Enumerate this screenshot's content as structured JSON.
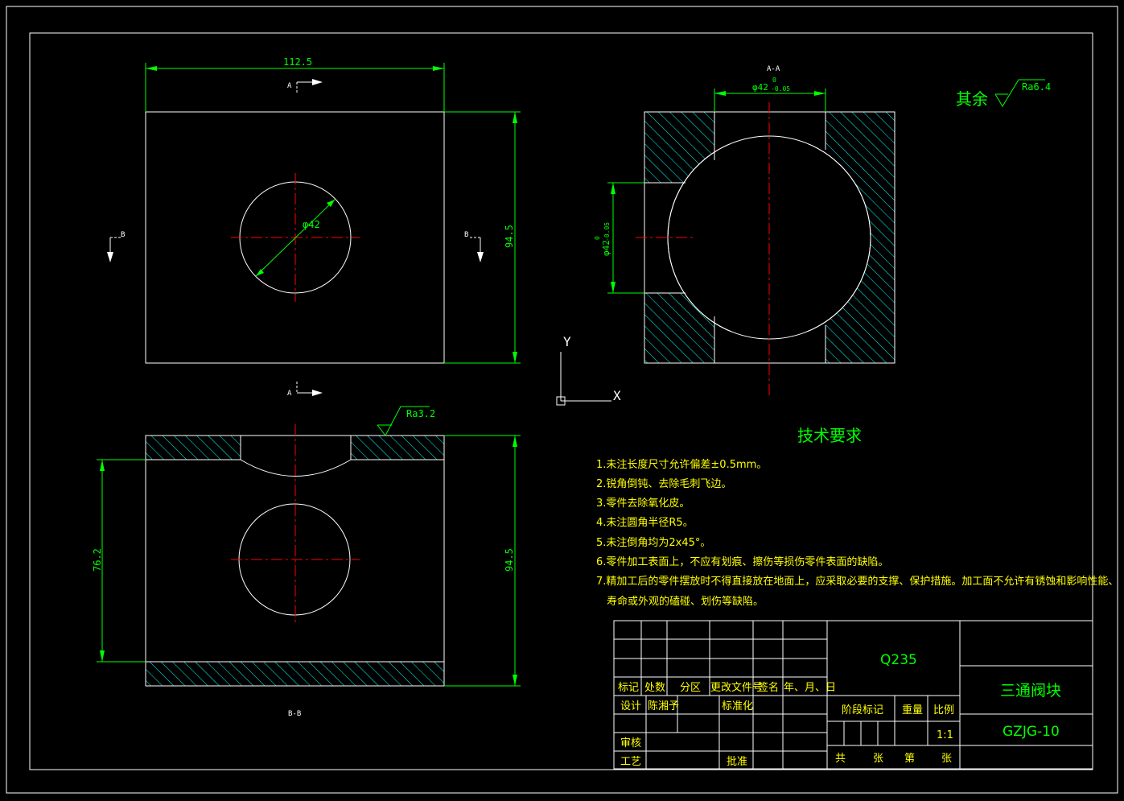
{
  "views": {
    "top": {
      "dim_width": "112.5",
      "dim_height": "94.5",
      "dim_hole": "φ42",
      "section_a_label": "A",
      "section_a_label_bottom": "A",
      "section_b_left": "B",
      "section_b_right": "B"
    },
    "section_aa": {
      "title": "A-A",
      "dim_top": "φ42",
      "dim_top_tol_upper": "0",
      "dim_top_tol_lower": "-0.05",
      "dim_left": "φ42",
      "dim_left_tol_upper": "0",
      "dim_left_tol_lower": "-0.05"
    },
    "section_bb": {
      "title": "B-B",
      "dim_left": "76.2",
      "dim_right": "94.5",
      "roughness": "Ra3.2"
    }
  },
  "axis_icon": {
    "x_label": "X",
    "y_label": "Y"
  },
  "roughness_note": {
    "prefix": "其余",
    "value": "Ra6.4"
  },
  "tech_requirements": {
    "title": "技术要求",
    "items": [
      "1.未注长度尺寸允许偏差±0.5mm。",
      "2.锐角倒钝、去除毛刺飞边。",
      "3.零件去除氧化皮。",
      "4.未注圆角半径R5。",
      "5.未注倒角均为2x45°。",
      "6.零件加工表面上，不应有划痕、擦伤等损伤零件表面的缺陷。",
      "7.精加工后的零件摆放时不得直接放在地面上，应采取必要的支撑、保护措施。加工面不允许有锈蚀和影响性能、",
      "寿命或外观的磕碰、划伤等缺陷。"
    ]
  },
  "title_block": {
    "material": "Q235",
    "part_name": "三通阀块",
    "drawing_no": "GZJG-10",
    "headers": [
      "标记",
      "处数",
      "分区",
      "更改文件号",
      "签名",
      "年、月、日"
    ],
    "design_label": "设计",
    "designer": "陈湘予",
    "standardize_label": "标准化",
    "review_label": "审核",
    "process_label": "工艺",
    "approve_label": "批准",
    "stage_label": "阶段标记",
    "weight_label": "重量",
    "scale_label": "比例",
    "scale_value": "1:1",
    "total_label": "共",
    "sheets_label": "张",
    "sheet_no_label": "第",
    "sheet_label": "张"
  },
  "colors": {
    "background": "#000000",
    "outline": "#ffffff",
    "dimension": "#00ff00",
    "centerline": "#ff0000",
    "hatch": "#00ffff",
    "text": "#ffff00"
  }
}
